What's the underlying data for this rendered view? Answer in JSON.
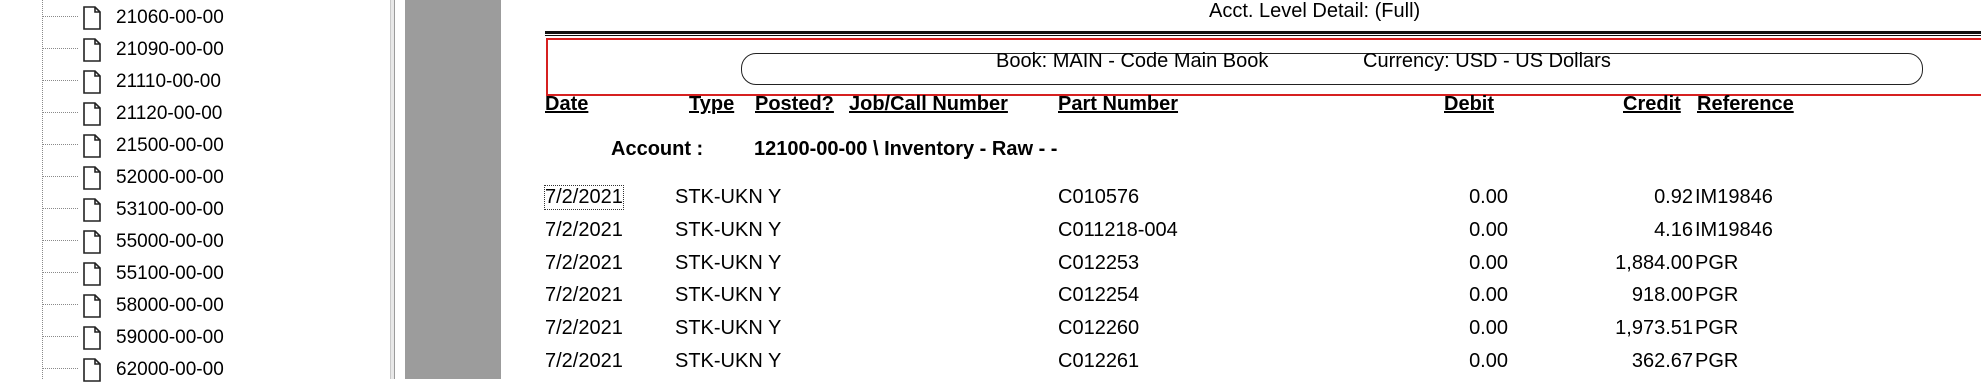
{
  "tree": {
    "items": [
      {
        "label": "21060-00-00",
        "icon": "document-icon"
      },
      {
        "label": "21090-00-00",
        "icon": "document-icon"
      },
      {
        "label": "21110-00-00",
        "icon": "document-icon"
      },
      {
        "label": "21120-00-00",
        "icon": "document-icon"
      },
      {
        "label": "21500-00-00",
        "icon": "document-icon"
      },
      {
        "label": "52000-00-00",
        "icon": "document-icon"
      },
      {
        "label": "53100-00-00",
        "icon": "document-icon"
      },
      {
        "label": "55000-00-00",
        "icon": "document-icon"
      },
      {
        "label": "55100-00-00",
        "icon": "document-icon"
      },
      {
        "label": "58000-00-00",
        "icon": "document-icon"
      },
      {
        "label": "59000-00-00",
        "icon": "document-icon"
      },
      {
        "label": "62000-00-00",
        "icon": "document-icon"
      }
    ]
  },
  "report": {
    "level_title": "Acct. Level Detail: (Full)",
    "book": "Book: MAIN - Code Main Book",
    "currency": "Currency: USD - US Dollars",
    "columns": {
      "date": "Date",
      "type": "Type",
      "posted": "Posted?",
      "job": "Job/Call Number",
      "part": "Part Number",
      "debit": "Debit",
      "credit": "Credit",
      "reference": "Reference"
    },
    "account_label": "Account :",
    "account_value": "12100-00-00 \\ Inventory - Raw - -",
    "rows": [
      {
        "date": "7/2/2021",
        "type": "STK-UKN",
        "posted": "Y",
        "part": "C010576",
        "debit": "0.00",
        "credit": "0.92",
        "reference": "IM19846"
      },
      {
        "date": "7/2/2021",
        "type": "STK-UKN",
        "posted": "Y",
        "part": "C011218-004",
        "debit": "0.00",
        "credit": "4.16",
        "reference": "IM19846"
      },
      {
        "date": "7/2/2021",
        "type": "STK-UKN",
        "posted": "Y",
        "part": "C012253",
        "debit": "0.00",
        "credit": "1,884.00",
        "reference": "PGR"
      },
      {
        "date": "7/2/2021",
        "type": "STK-UKN",
        "posted": "Y",
        "part": "C012254",
        "debit": "0.00",
        "credit": "918.00",
        "reference": "PGR"
      },
      {
        "date": "7/2/2021",
        "type": "STK-UKN",
        "posted": "Y",
        "part": "C012260",
        "debit": "0.00",
        "credit": "1,973.51",
        "reference": "PGR"
      },
      {
        "date": "7/2/2021",
        "type": "STK-UKN",
        "posted": "Y",
        "part": "C012261",
        "debit": "0.00",
        "credit": "362.67",
        "reference": "PGR"
      }
    ]
  }
}
